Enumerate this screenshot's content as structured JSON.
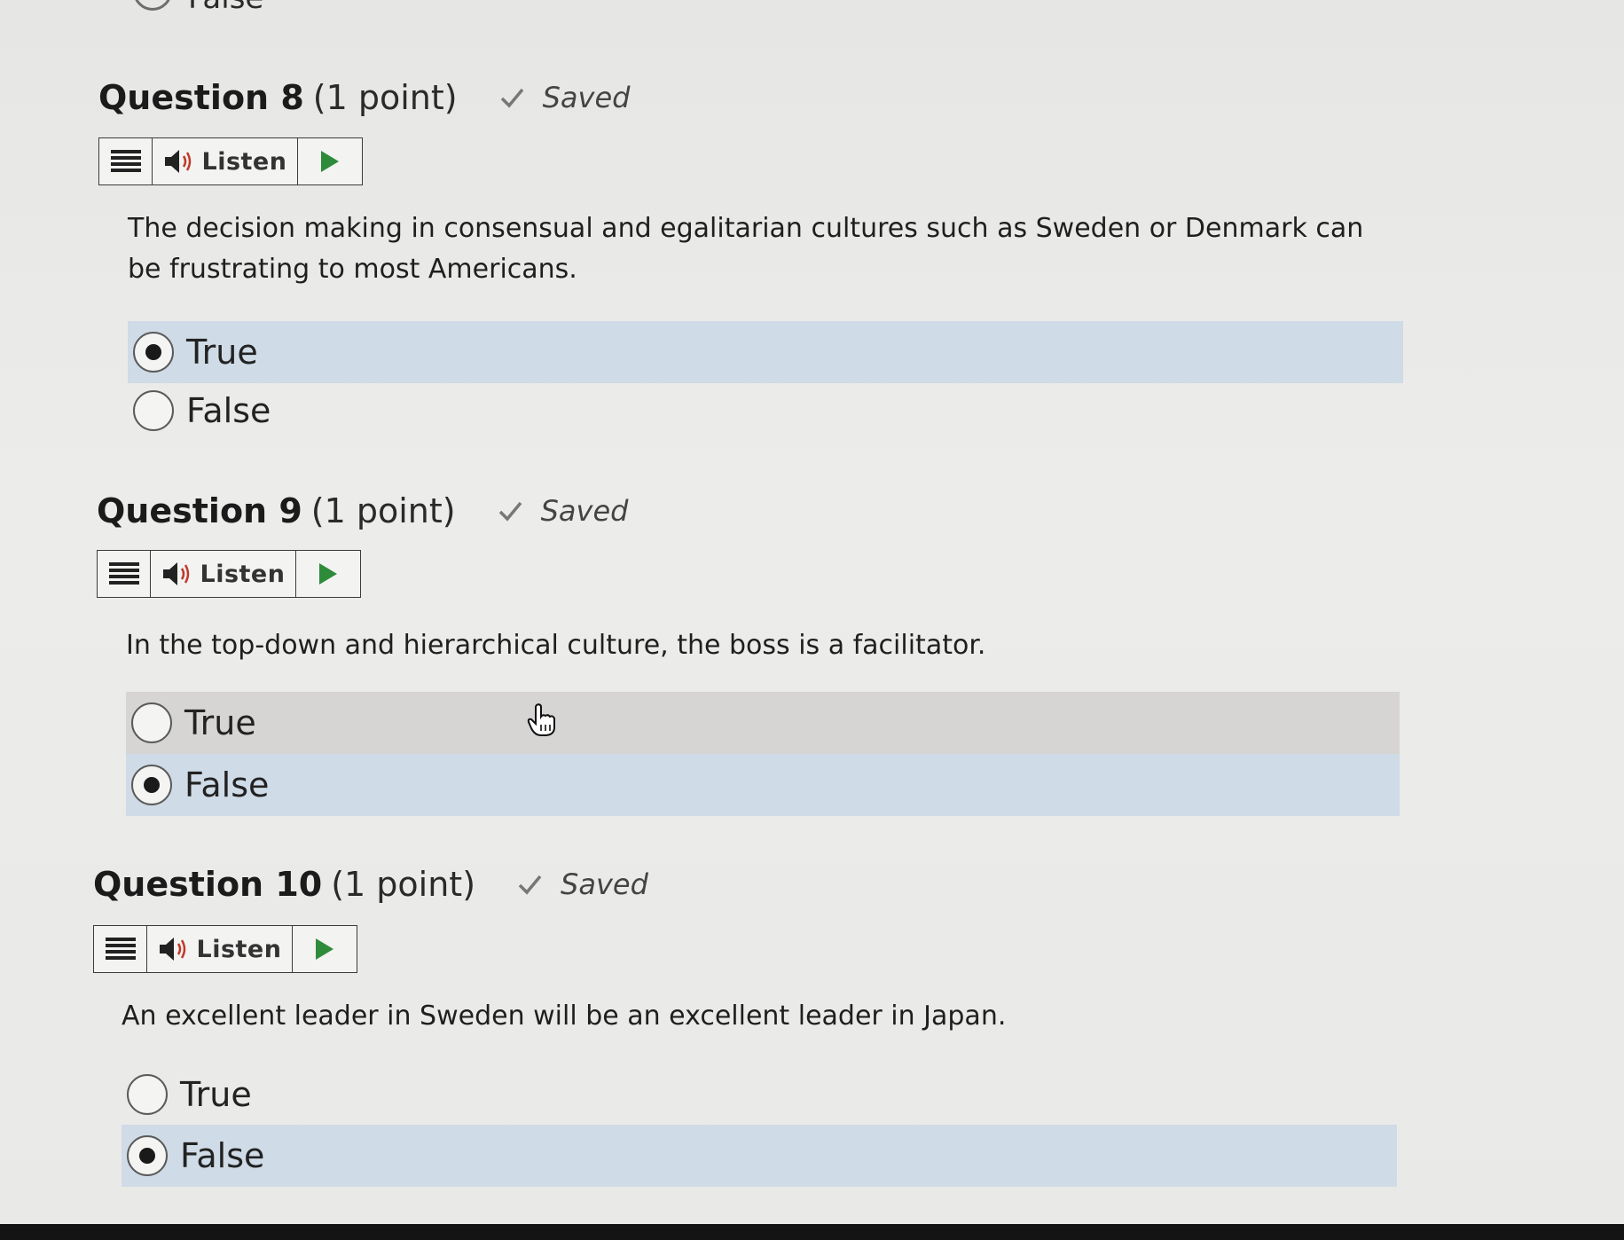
{
  "previous_question": {
    "option_label": "False"
  },
  "questions": [
    {
      "title": "Question 8",
      "points": "(1 point)",
      "status": "Saved",
      "listen_label": "Listen",
      "prompt": "The decision making in consensual and egalitarian cultures such as Sweden or Denmark can be frustrating to most Americans.",
      "options": [
        {
          "label": "True",
          "selected": true
        },
        {
          "label": "False",
          "selected": false
        }
      ]
    },
    {
      "title": "Question 9",
      "points": "(1 point)",
      "status": "Saved",
      "listen_label": "Listen",
      "prompt": "In the top-down and hierarchical culture, the boss is a facilitator.",
      "options": [
        {
          "label": "True",
          "selected": false
        },
        {
          "label": "False",
          "selected": true
        }
      ]
    },
    {
      "title": "Question 10",
      "points": "(1 point)",
      "status": "Saved",
      "listen_label": "Listen",
      "prompt": "An excellent leader in Sweden will be an excellent leader in Japan.",
      "options": [
        {
          "label": "True",
          "selected": false
        },
        {
          "label": "False",
          "selected": true
        }
      ]
    }
  ],
  "colors": {
    "selected_row": "#cfdbe6",
    "hover_row": "#d6d5d3",
    "play_green": "#2e8b3a"
  }
}
